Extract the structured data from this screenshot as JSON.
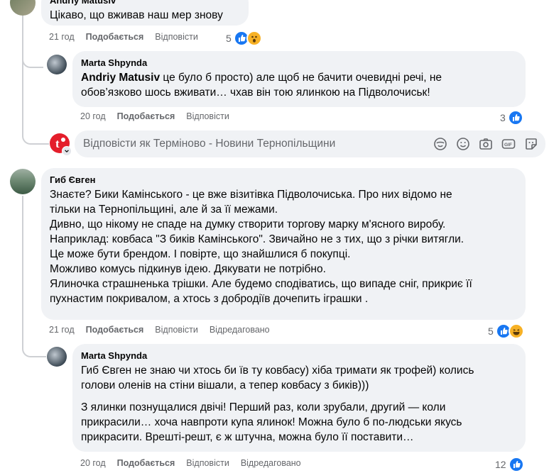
{
  "comments": [
    {
      "author": "Andriy Matusiv",
      "text": "Цікаво, що вживав наш мер знову",
      "time": "21 год",
      "like_label": "Подобається",
      "reply_label": "Відповісти",
      "reaction_count": "5"
    },
    {
      "author": "Marta Shpynda",
      "mention": "Andriy Matusiv",
      "text_line1": "це було б просто) але щоб не бачити очевидні речі, не",
      "text_line2": "обов’язково шось вживати… чхав він тою ялинкою на Підволочиськ!",
      "time": "20 год",
      "like_label": "Подобається",
      "reply_label": "Відповісти",
      "reaction_count": "3"
    },
    {
      "author": "Гиб Євген",
      "lines": [
        "Знаєте? Бики Камінського - це вже візитівка Підволочиська. Про них відомо не",
        "тільки на Тернопільщині, але й за її межами.",
        "Дивно, що нікому не спаде на думку створити торгову марку м'ясного виробу.",
        "Наприклад: ковбаса \"З биків Камінського\". Звичайно не з тих, що з річки витягли.",
        "Це може бути брендом. І повірте, що знайшлися б покупці.",
        "Можливо комусь підкинув ідею. Дякувати не потрібно.",
        "Ялиночка страшненька трішки. Але будемо сподіватись, що випаде сніг, прикриє її",
        "пухнастим покривалом, а хтось з добродіїв дочепить іграшки ."
      ],
      "time": "21 год",
      "like_label": "Подобається",
      "reply_label": "Відповісти",
      "edited_label": "Відредаговано",
      "reaction_count": "5"
    },
    {
      "author": "Marta Shpynda",
      "para1_lines": [
        "Гиб Євген не знаю чи хтось би їв ту ковбасу) хіба тримати як трофей) колись",
        "голови оленів на стіни вішали, а тепер ковбасу з биків)))"
      ],
      "para2_lines": [
        "З ялинки познущалися двічі! Перший раз, коли зрубали, другий — коли",
        "прикрасили… хоча навпроти купа ялинок! Можна було б по-людськи якусь",
        "прикрасити. Врешті-решт, є ж штучна, можна було її поставити…"
      ],
      "time": "20 год",
      "like_label": "Подобається",
      "reply_label": "Відповісти",
      "edited_label": "Відредаговано",
      "reaction_count": "12"
    }
  ],
  "reply_box": {
    "placeholder": "Відповісти як Терміново - Новини Тернопільщини",
    "icons": [
      "sticker-icon",
      "emoji-icon",
      "camera-icon",
      "gif-icon",
      "sticker-face-icon"
    ]
  },
  "colors": {
    "like_blue": "#1877f2",
    "haha_yellow": "#f7b125",
    "brand_red": "#e41e2b"
  }
}
